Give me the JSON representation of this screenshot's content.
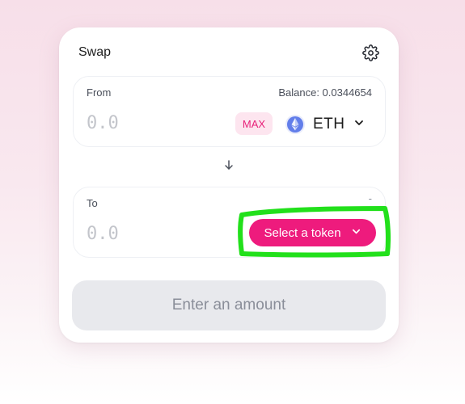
{
  "swap": {
    "title": "Swap",
    "settings_icon": "gear-icon"
  },
  "from": {
    "label": "From",
    "balance": "Balance: 0.0344654",
    "amount_placeholder": "0.0",
    "max_label": "MAX",
    "token_icon": "ethereum-icon",
    "token_symbol": "ETH"
  },
  "switch_icon": "arrow-down-icon",
  "to": {
    "label": "To",
    "balance": "-",
    "amount_placeholder": "0.0",
    "select_token_label": "Select a token"
  },
  "submit": {
    "label": "Enter an amount"
  },
  "colors": {
    "accent": "#ee1b7d",
    "max_bg": "#fde5ef",
    "highlight": "#22e01b",
    "eth": "#627eea"
  }
}
